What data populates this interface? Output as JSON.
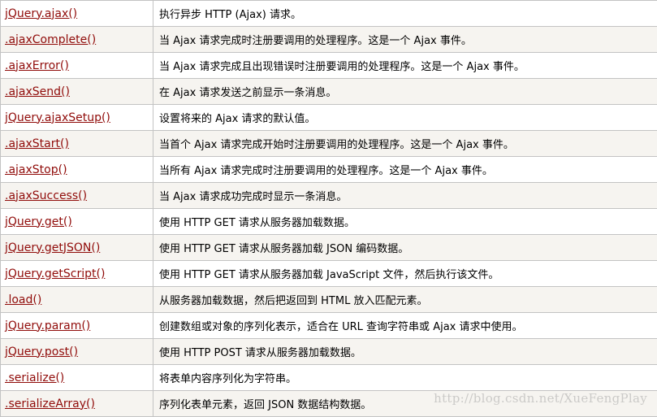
{
  "rows": [
    {
      "method": "jQuery.ajax()",
      "description": "执行异步 HTTP (Ajax) 请求。"
    },
    {
      "method": ".ajaxComplete()",
      "description": "当 Ajax 请求完成时注册要调用的处理程序。这是一个 Ajax 事件。"
    },
    {
      "method": ".ajaxError()",
      "description": "当 Ajax 请求完成且出现错误时注册要调用的处理程序。这是一个 Ajax 事件。"
    },
    {
      "method": ".ajaxSend()",
      "description": "在 Ajax 请求发送之前显示一条消息。"
    },
    {
      "method": "jQuery.ajaxSetup()",
      "description": "设置将来的 Ajax 请求的默认值。"
    },
    {
      "method": ".ajaxStart()",
      "description": "当首个 Ajax 请求完成开始时注册要调用的处理程序。这是一个 Ajax 事件。"
    },
    {
      "method": ".ajaxStop()",
      "description": "当所有 Ajax 请求完成时注册要调用的处理程序。这是一个 Ajax 事件。"
    },
    {
      "method": ".ajaxSuccess()",
      "description": "当 Ajax 请求成功完成时显示一条消息。"
    },
    {
      "method": "jQuery.get()",
      "description": "使用 HTTP GET 请求从服务器加载数据。"
    },
    {
      "method": "jQuery.getJSON()",
      "description": "使用 HTTP GET 请求从服务器加载 JSON 编码数据。"
    },
    {
      "method": "jQuery.getScript()",
      "description": "使用 HTTP GET 请求从服务器加载 JavaScript 文件，然后执行该文件。"
    },
    {
      "method": ".load()",
      "description": "从服务器加载数据，然后把返回到 HTML 放入匹配元素。"
    },
    {
      "method": "jQuery.param()",
      "description": "创建数组或对象的序列化表示，适合在 URL 查询字符串或 Ajax 请求中使用。"
    },
    {
      "method": "jQuery.post()",
      "description": "使用 HTTP POST 请求从服务器加载数据。"
    },
    {
      "method": ".serialize()",
      "description": "将表单内容序列化为字符串。"
    },
    {
      "method": ".serializeArray()",
      "description": "序列化表单元素，返回 JSON 数据结构数据。"
    }
  ],
  "watermark": "http://blog.csdn.net/XueFengPlay",
  "colors": {
    "link": "#900b09",
    "row_alt_bg": "#f6f4f0",
    "border": "#c3c3c3"
  }
}
